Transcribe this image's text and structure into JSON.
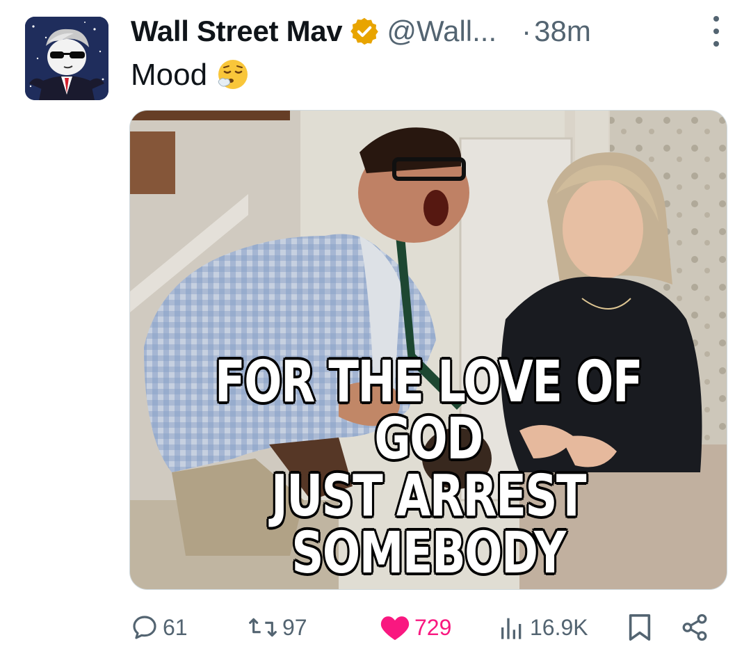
{
  "author": {
    "display_name": "Wall Street Mav",
    "handle": "@Wall...",
    "verified_badge": "gold-verified-badge",
    "separator": "·",
    "time_ago": "38m"
  },
  "tweet": {
    "text": "Mood",
    "emoji": "😮‍💨"
  },
  "media": {
    "caption_line1": "FOR THE LOVE OF GOD",
    "caption_line2": "JUST ARREST SOMEBODY"
  },
  "actions": {
    "replies": "61",
    "reposts": "97",
    "likes": "729",
    "views": "16.9K"
  },
  "colors": {
    "like_active": "#f91880",
    "muted": "#536471",
    "verified_gold": "#e8a400"
  }
}
